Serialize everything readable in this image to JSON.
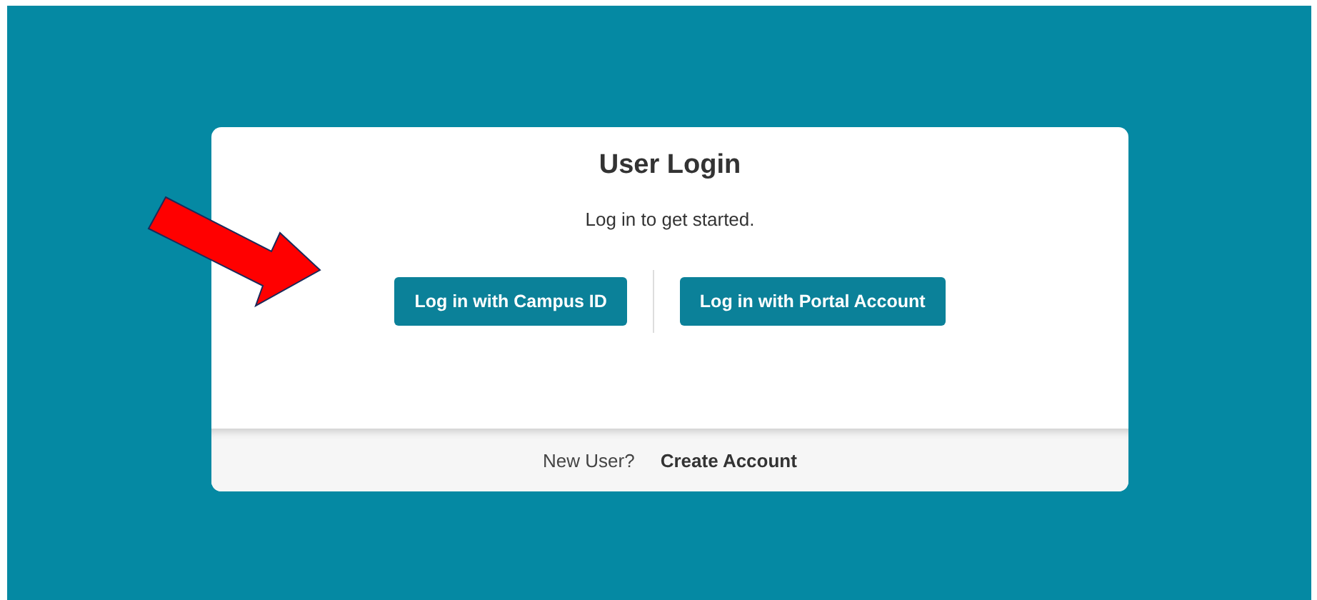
{
  "card": {
    "title": "User Login",
    "subtitle": "Log in to get started.",
    "buttons": [
      "Log in with Campus ID",
      "Log in with Portal Account"
    ],
    "footer": {
      "prompt": "New User?",
      "link": "Create Account"
    }
  },
  "annotation": {
    "kind": "arrow"
  }
}
